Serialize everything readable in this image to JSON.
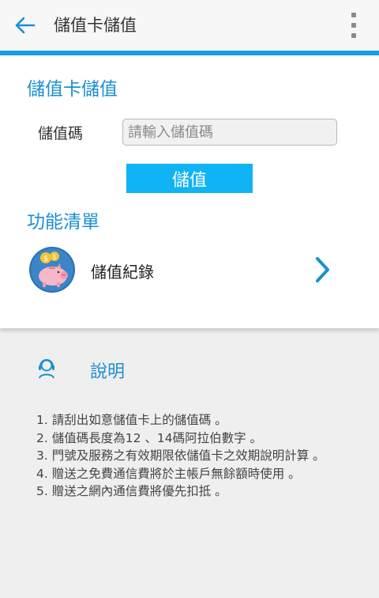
{
  "appbar": {
    "title": "儲值卡儲值"
  },
  "topup": {
    "title": "儲值卡儲值",
    "field_label": "儲值碼",
    "placeholder": "請輸入儲值碼",
    "submit_label": "儲值"
  },
  "menu": {
    "title": "功能清單",
    "items": [
      {
        "label": "儲值紀錄"
      }
    ]
  },
  "info": {
    "title": "說明",
    "notes": [
      "1. 請刮出如意儲值卡上的儲值碼 。",
      "2. 儲值碼長度為12 、14碼阿拉伯數字 。",
      "3. 門號及服務之有效期限依儲值卡之效期說明計算 。",
      "4. 贈送之免費通信費將於主帳戶無餘額時使用 。",
      "5. 贈送之網內通信費將優先扣抵 。"
    ]
  },
  "colors": {
    "accent": "#1a9fe0",
    "title_blue": "#1a8fd1",
    "button": "#10b3f4"
  }
}
